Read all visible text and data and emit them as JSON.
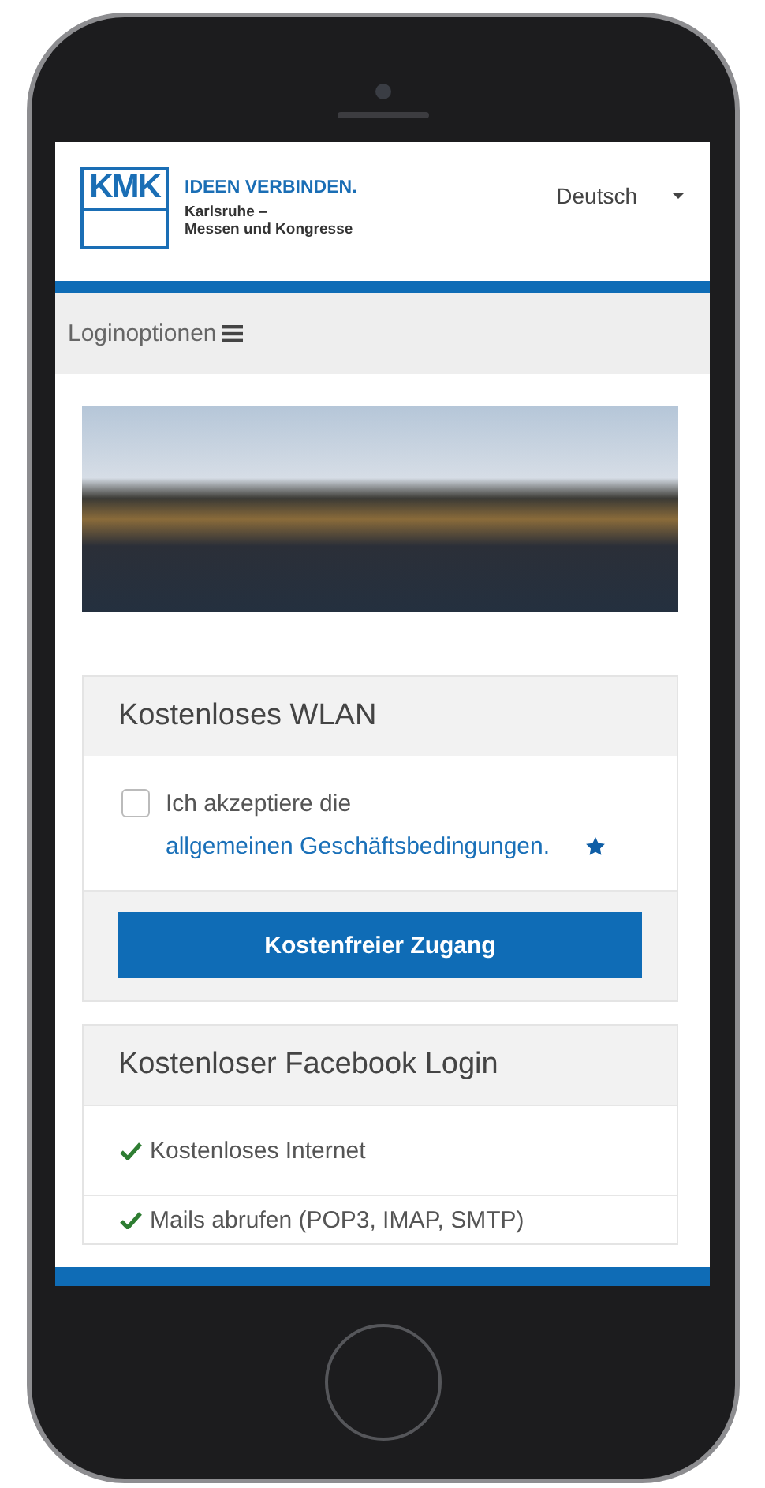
{
  "header": {
    "logo_mark": "KMK",
    "logo_tagline": "IDEEN VERBINDEN.",
    "logo_subtitle_1": "Karlsruhe –",
    "logo_subtitle_2": "Messen und Kongresse",
    "language": "Deutsch"
  },
  "menu_bar": {
    "label": "Loginoptionen"
  },
  "cards": [
    {
      "kind": "terms",
      "title": "Kostenloses WLAN",
      "terms": {
        "checked": false,
        "text": "Ich akzeptiere die",
        "link": "allgemeinen Geschäftsbedingungen."
      },
      "button": "Kostenfreier Zugang"
    },
    {
      "kind": "features",
      "title": "Kostenloser Facebook Login",
      "features": [
        "Kostenloses Internet",
        "Mails abrufen (POP3, IMAP, SMTP)"
      ]
    }
  ]
}
